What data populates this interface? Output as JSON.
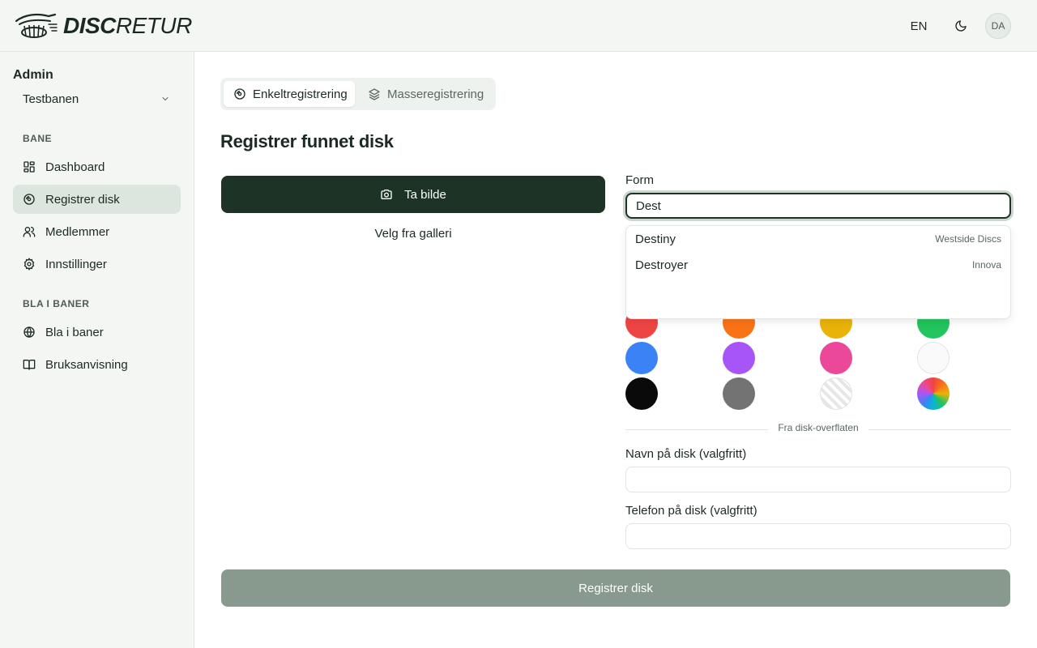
{
  "header": {
    "logo_bold": "DISC",
    "logo_light": "RETUR",
    "language": "EN",
    "avatar_initials": "DA"
  },
  "sidebar": {
    "title": "Admin",
    "selected_course": "Testbanen",
    "sections": [
      {
        "heading": "BANE",
        "items": [
          {
            "label": "Dashboard",
            "icon": "dashboard-icon"
          },
          {
            "label": "Registrer disk",
            "icon": "disc-icon",
            "active": true
          },
          {
            "label": "Medlemmer",
            "icon": "users-icon"
          },
          {
            "label": "Innstillinger",
            "icon": "gear-icon"
          }
        ]
      },
      {
        "heading": "BLA I BANER",
        "items": [
          {
            "label": "Bla i baner",
            "icon": "globe-icon"
          },
          {
            "label": "Bruksanvisning",
            "icon": "book-icon"
          }
        ]
      }
    ]
  },
  "tabs": [
    {
      "label": "Enkeltregistrering",
      "icon": "disc-icon",
      "active": true
    },
    {
      "label": "Masseregistrering",
      "icon": "layers-icon",
      "active": false
    }
  ],
  "main": {
    "title": "Registrer funnet disk",
    "photo_button": "Ta bilde",
    "gallery_button": "Velg fra galleri",
    "form_label": "Form",
    "form_value": "Dest",
    "suggestions": [
      {
        "name": "Destiny",
        "brand": "Westside Discs"
      },
      {
        "name": "Destroyer",
        "brand": "Innova"
      }
    ],
    "colors": [
      "#ef4444",
      "#f97316",
      "#eab308",
      "#22c55e",
      "#3b82f6",
      "#a855f7",
      "#ec4899",
      "#fafafa",
      "#0a0a0a",
      "#737373",
      "striped",
      "rainbow"
    ],
    "divider_text": "Fra disk-overflaten",
    "name_label": "Navn på disk (valgfritt)",
    "phone_label": "Telefon på disk (valgfritt)",
    "submit_button": "Registrer disk"
  }
}
